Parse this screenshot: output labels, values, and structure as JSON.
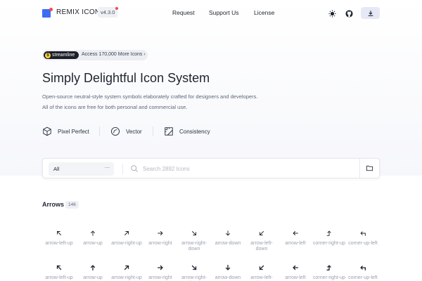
{
  "header": {
    "brand": "REMIX ICON",
    "version": "v4.3.0",
    "nav": [
      "Request",
      "Support Us",
      "License"
    ],
    "accent": "#3d6df5"
  },
  "badge": {
    "logo_text": "streamline",
    "logo_glyph": "$",
    "text": "Access 170,000 More Icons ›"
  },
  "hero": {
    "title": "Simply Delightful Icon System",
    "desc1": "Open-source neutral-style system symbols elaborately crafted for designers and developers.",
    "desc2": "All of the icons are free for both personal and commercial use."
  },
  "features": [
    {
      "label": "Pixel Perfect",
      "icon": "cube-icon"
    },
    {
      "label": "Vector",
      "icon": "pen-nib-icon"
    },
    {
      "label": "Consistency",
      "icon": "grid-ruler-icon"
    }
  ],
  "search": {
    "select_value": "All",
    "placeholder": "Search 2892 Icons",
    "value": ""
  },
  "category": {
    "title": "Arrows",
    "count": "146"
  },
  "icons_row1": [
    {
      "label": "arrow-left-up",
      "dir": "left-up"
    },
    {
      "label": "arrow-up",
      "dir": "up"
    },
    {
      "label": "arrow-right-up",
      "dir": "right-up"
    },
    {
      "label": "arrow-right",
      "dir": "right"
    },
    {
      "label": "arrow-right-down",
      "dir": "right-down"
    },
    {
      "label": "arrow-down",
      "dir": "down"
    },
    {
      "label": "arrow-left-down",
      "dir": "left-down"
    },
    {
      "label": "arrow-left",
      "dir": "left"
    },
    {
      "label": "corner-right-up",
      "dir": "corner-right-up"
    },
    {
      "label": "corner-up-left",
      "dir": "corner-up-left"
    }
  ],
  "icons_row2": [
    {
      "label": "arrow-left-up",
      "dir": "left-up"
    },
    {
      "label": "arrow-up",
      "dir": "up"
    },
    {
      "label": "arrow-right-up",
      "dir": "right-up"
    },
    {
      "label": "arrow-right",
      "dir": "right"
    },
    {
      "label": "arrow-right-down",
      "dir": "right-down"
    },
    {
      "label": "arrow-down",
      "dir": "down"
    },
    {
      "label": "arrow-left-down",
      "dir": "left-down"
    },
    {
      "label": "arrow-left",
      "dir": "left"
    },
    {
      "label": "corner-right-up",
      "dir": "corner-right-up"
    },
    {
      "label": "corner-up-left",
      "dir": "corner-up-left"
    }
  ]
}
